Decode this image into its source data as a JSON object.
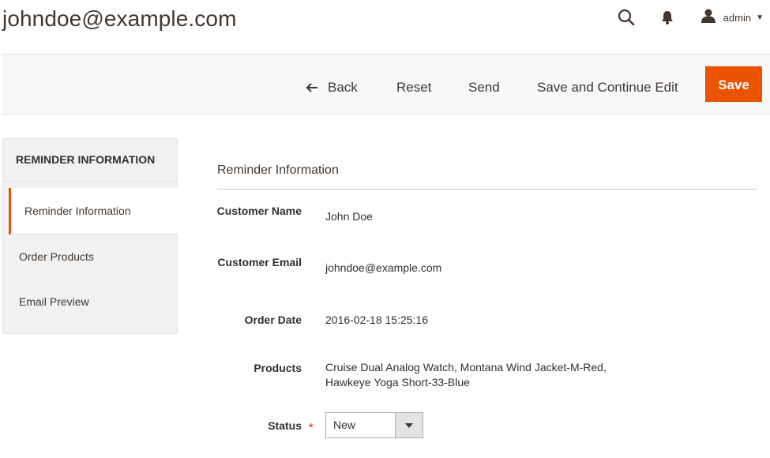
{
  "header": {
    "title": "johndoe@example.com",
    "user_label": "admin",
    "icons": [
      "search-icon",
      "notifications-bell-icon",
      "user-icon"
    ]
  },
  "toolbar": {
    "back_label": "Back",
    "reset_label": "Reset",
    "send_label": "Send",
    "save_continue_label": "Save and Continue Edit",
    "save_label": "Save",
    "save_color": "#eb5202"
  },
  "sidebar": {
    "title": "REMINDER INFORMATION",
    "items": [
      {
        "label": "Reminder Information",
        "active": true
      },
      {
        "label": "Order Products",
        "active": false
      },
      {
        "label": "Email Preview",
        "active": false
      }
    ]
  },
  "main": {
    "section_title": "Reminder Information",
    "fields": {
      "customer_name": {
        "label": "Customer Name",
        "value": "John Doe"
      },
      "customer_email": {
        "label": "Customer Email",
        "value": "johndoe@example.com"
      },
      "order_date": {
        "label": "Order Date",
        "value": "2016-02-18 15:25:16"
      },
      "products": {
        "label": "Products",
        "value_line1": "Cruise Dual Analog Watch, Montana Wind Jacket-M-Red,",
        "value_line2": "Hawkeye Yoga Short-33-Blue"
      },
      "status": {
        "label": "Status",
        "value": "New",
        "required_mark": "*"
      }
    }
  }
}
